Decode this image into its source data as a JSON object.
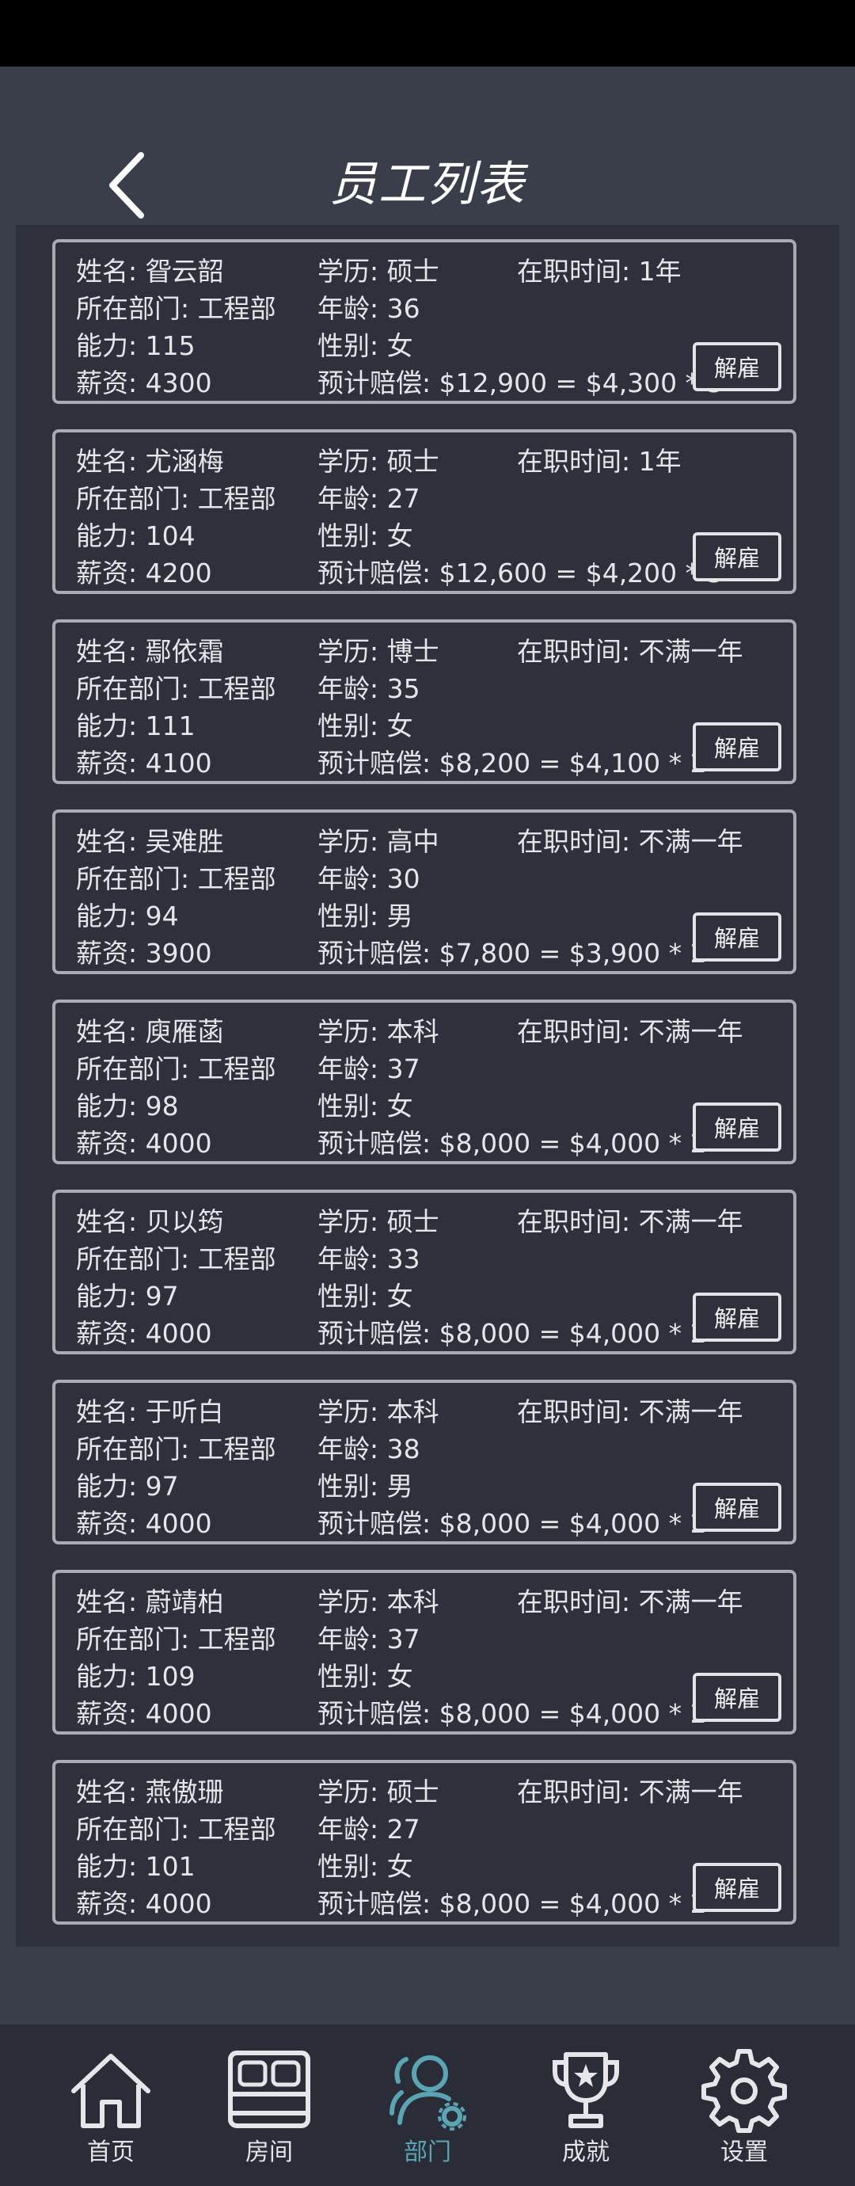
{
  "header": {
    "title": "员工列表"
  },
  "employees": [
    {
      "name": "姓名: 眢云韶",
      "education": "学历: 硕士",
      "tenure": "在职时间: 1年",
      "department": "所在部门: 工程部",
      "age": "年龄: 36",
      "ability": "能力: 115",
      "gender": "性别: 女",
      "salary": "薪资: 4300",
      "compensation": "预计赔偿: $12,900 = $4,300 * 3",
      "fire_label": "解雇"
    },
    {
      "name": "姓名: 尤涵梅",
      "education": "学历: 硕士",
      "tenure": "在职时间: 1年",
      "department": "所在部门: 工程部",
      "age": "年龄: 27",
      "ability": "能力: 104",
      "gender": "性别: 女",
      "salary": "薪资: 4200",
      "compensation": "预计赔偿: $12,600 = $4,200 * 3",
      "fire_label": "解雇"
    },
    {
      "name": "姓名: 鄢依霜",
      "education": "学历: 博士",
      "tenure": "在职时间: 不满一年",
      "department": "所在部门: 工程部",
      "age": "年龄: 35",
      "ability": "能力: 111",
      "gender": "性别: 女",
      "salary": "薪资: 4100",
      "compensation": "预计赔偿: $8,200 = $4,100 * 2",
      "fire_label": "解雇"
    },
    {
      "name": "姓名: 吴难胜",
      "education": "学历: 高中",
      "tenure": "在职时间: 不满一年",
      "department": "所在部门: 工程部",
      "age": "年龄: 30",
      "ability": "能力: 94",
      "gender": "性别: 男",
      "salary": "薪资: 3900",
      "compensation": "预计赔偿: $7,800 = $3,900 * 2",
      "fire_label": "解雇"
    },
    {
      "name": "姓名: 庾雁菡",
      "education": "学历: 本科",
      "tenure": "在职时间: 不满一年",
      "department": "所在部门: 工程部",
      "age": "年龄: 37",
      "ability": "能力: 98",
      "gender": "性别: 女",
      "salary": "薪资: 4000",
      "compensation": "预计赔偿: $8,000 = $4,000 * 2",
      "fire_label": "解雇"
    },
    {
      "name": "姓名: 贝以筠",
      "education": "学历: 硕士",
      "tenure": "在职时间: 不满一年",
      "department": "所在部门: 工程部",
      "age": "年龄: 33",
      "ability": "能力: 97",
      "gender": "性别: 女",
      "salary": "薪资: 4000",
      "compensation": "预计赔偿: $8,000 = $4,000 * 2",
      "fire_label": "解雇"
    },
    {
      "name": "姓名: 于听白",
      "education": "学历: 本科",
      "tenure": "在职时间: 不满一年",
      "department": "所在部门: 工程部",
      "age": "年龄: 38",
      "ability": "能力: 97",
      "gender": "性别: 男",
      "salary": "薪资: 4000",
      "compensation": "预计赔偿: $8,000 = $4,000 * 2",
      "fire_label": "解雇"
    },
    {
      "name": "姓名: 蔚靖柏",
      "education": "学历: 本科",
      "tenure": "在职时间: 不满一年",
      "department": "所在部门: 工程部",
      "age": "年龄: 37",
      "ability": "能力: 109",
      "gender": "性别: 女",
      "salary": "薪资: 4000",
      "compensation": "预计赔偿: $8,000 = $4,000 * 2",
      "fire_label": "解雇"
    },
    {
      "name": "姓名: 燕傲珊",
      "education": "学历: 硕士",
      "tenure": "在职时间: 不满一年",
      "department": "所在部门: 工程部",
      "age": "年龄: 27",
      "ability": "能力: 101",
      "gender": "性别: 女",
      "salary": "薪资: 4000",
      "compensation": "预计赔偿: $8,000 = $4,000 * 2",
      "fire_label": "解雇"
    }
  ],
  "nav": {
    "items": [
      {
        "label": "首页",
        "icon": "home-icon"
      },
      {
        "label": "房间",
        "icon": "bed-icon"
      },
      {
        "label": "部门",
        "icon": "department-icon",
        "active": true
      },
      {
        "label": "成就",
        "icon": "trophy-icon"
      },
      {
        "label": "设置",
        "icon": "gear-icon"
      }
    ]
  },
  "colors": {
    "background": "#3a3e4b",
    "panel": "#2e313b",
    "accent": "#5aa4b4",
    "border": "#a9abb0"
  }
}
